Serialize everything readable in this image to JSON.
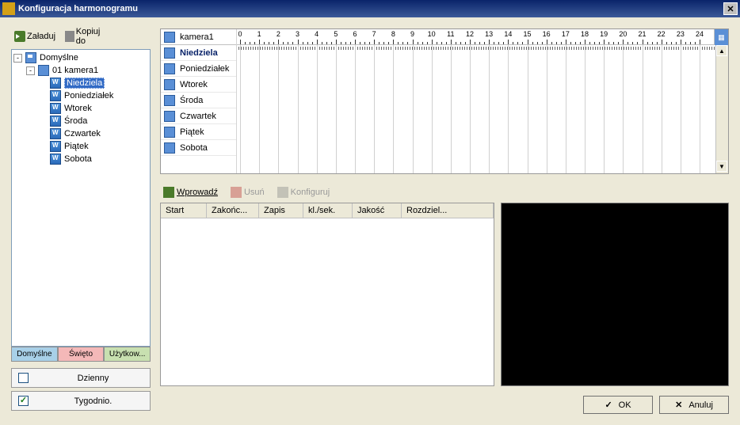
{
  "window": {
    "title": "Konfiguracja harmonogramu"
  },
  "toolbar": {
    "load": "Załaduj",
    "copy": "Kopiuj do"
  },
  "tree": {
    "root": "Domyślne",
    "camera": "01 kamera1",
    "days": [
      "Niedziela",
      "Poniedziałek",
      "Wtorek",
      "Środa",
      "Czwartek",
      "Piątek",
      "Sobota"
    ],
    "selected_index": 0
  },
  "tabs": {
    "default": "Domyślne",
    "holiday": "Święto",
    "user": "Użytkow..."
  },
  "modes": {
    "daily": {
      "label": "Dzienny",
      "checked": false
    },
    "weekly": {
      "label": "Tygodnio.",
      "checked": true
    }
  },
  "schedule": {
    "camera_label": "kamera1",
    "days": [
      "Niedziela",
      "Poniedziałek",
      "Wtorek",
      "Środa",
      "Czwartek",
      "Piątek",
      "Sobota"
    ],
    "selected_index": 0,
    "hours": [
      "0",
      "1",
      "2",
      "3",
      "4",
      "5",
      "6",
      "7",
      "8",
      "9",
      "10",
      "11",
      "12",
      "13",
      "14",
      "15",
      "16",
      "17",
      "18",
      "19",
      "20",
      "21",
      "22",
      "23",
      "24"
    ]
  },
  "mid": {
    "add": "Wprowadź",
    "delete": "Usuń",
    "config": "Konfiguruj"
  },
  "table": {
    "columns": [
      "Start",
      "Zakońc...",
      "Zapis",
      "kl./sek.",
      "Jakość",
      "Rozdziel..."
    ]
  },
  "dialog": {
    "ok": "OK",
    "cancel": "Anuluj"
  }
}
